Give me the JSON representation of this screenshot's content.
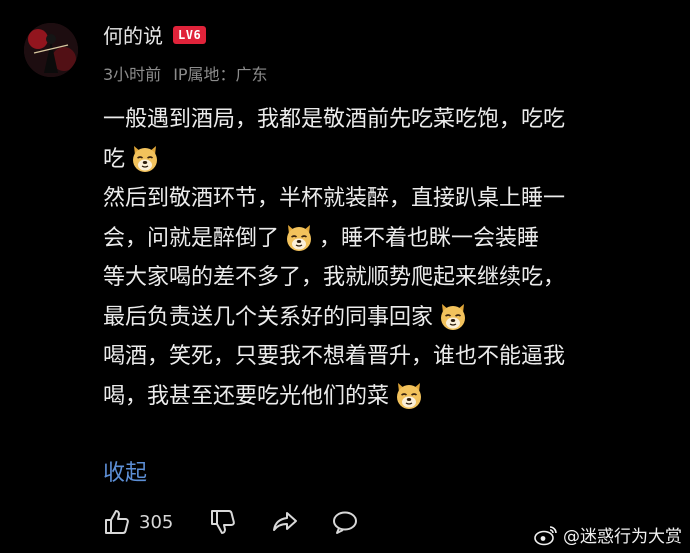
{
  "comment": {
    "username": "何的说",
    "level": "LV6",
    "time": "3小时前",
    "location": "IP属地：广东",
    "text_lines": [
      [
        "一般遇到酒局，我都是敬酒前先吃菜吃饱，吃吃"
      ],
      [
        "吃"
      ],
      [
        "然后到敬酒环节，半杯就装醉，直接趴桌上睡一"
      ],
      [
        "会，问就是醉倒了",
        "，睡不着也眯一会装睡"
      ],
      [
        "等大家喝的差不多了，我就顺势爬起来继续吃，"
      ],
      [
        "最后负责送几个关系好的同事回家"
      ],
      [
        "喝酒，笑死，只要我不想着晋升，谁也不能逼我"
      ],
      [
        "喝，我甚至还要吃光他们的菜"
      ]
    ],
    "collapse_label": "收起",
    "like_count": "305"
  },
  "icons": {
    "emoji": "doge-emoji-icon",
    "like": "thumbs-up-icon",
    "dislike": "thumbs-down-icon",
    "share": "share-icon",
    "reply": "comment-bubble-icon",
    "watermark": "weibo-logo-icon"
  },
  "watermark": {
    "text": "@迷惑行为大赏"
  },
  "colors": {
    "background": "#000000",
    "level_badge": "#e0233a",
    "link": "#5d8fd6",
    "meta": "#8c8c8c"
  }
}
